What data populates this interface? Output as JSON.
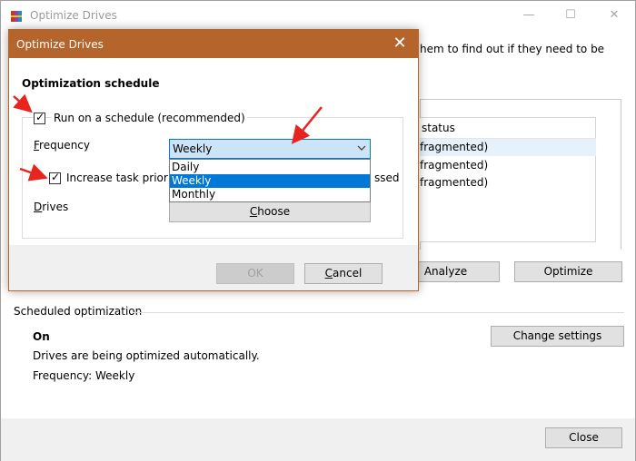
{
  "main_window": {
    "title": "Optimize Drives",
    "minimize_glyph": "—",
    "maximize_glyph": "☐",
    "close_glyph": "✕",
    "intro_text": "hem to find out if they need to be",
    "status_column_header": "status",
    "status_rows": [
      "fragmented)",
      "fragmented)",
      "fragmented)"
    ],
    "analyze_button": "Analyze",
    "optimize_button": "Optimize",
    "scheduled_heading": "Scheduled optimization",
    "schedule_state": "On",
    "schedule_description": "Drives are being optimized automatically.",
    "schedule_frequency": "Frequency: Weekly",
    "change_settings_button": "Change settings",
    "close_button": "Close"
  },
  "dialog": {
    "title": "Optimize Drives",
    "close_glyph": "✕",
    "heading": "Optimization schedule",
    "run_on_schedule": {
      "label": "Run on a schedule (recommended)",
      "checked": true
    },
    "frequency_label": "Frequency",
    "frequency_label_rest": "requency",
    "frequency_label_first": "F",
    "frequency_select": {
      "value": "Weekly",
      "options": [
        "Daily",
        "Weekly",
        "Monthly"
      ],
      "selected_index": 1
    },
    "increase_priority": {
      "label": "Increase task priority,",
      "label_tail": "ssed",
      "checked": true
    },
    "drives_label_first": "D",
    "drives_label_rest": "rives",
    "choose_button_first": "C",
    "choose_button_rest": "hoose",
    "ok_button": "OK",
    "cancel_button_first": "C",
    "cancel_button_rest": "ancel"
  },
  "colors": {
    "dialog_titlebar": "#b5642b",
    "selection_blue": "#0078d7",
    "select_focus_bg": "#cce4f7",
    "annotation_red": "#e8241f"
  },
  "icons": {
    "app_icon": "defrag-icon",
    "checkbox_mark": "✓",
    "dropdown_arrow": "chevron-down-icon"
  }
}
